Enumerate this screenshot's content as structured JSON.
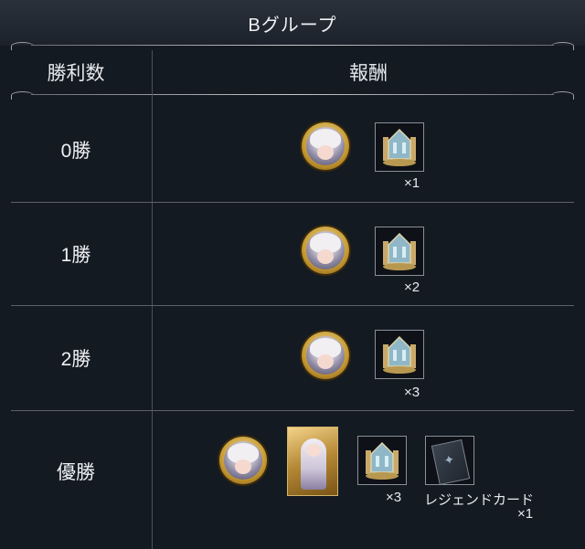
{
  "title": "Bグループ",
  "headers": {
    "wins": "勝利数",
    "reward": "報酬"
  },
  "rows": [
    {
      "wins": "0勝",
      "crown_qty": "×1"
    },
    {
      "wins": "1勝",
      "crown_qty": "×2"
    },
    {
      "wins": "2勝",
      "crown_qty": "×3"
    },
    {
      "wins": "優勝",
      "crown_qty": "×3",
      "legend_label": "レジェンドカード",
      "legend_qty": "×1"
    }
  ],
  "icons": {
    "medal": "character-medal-icon",
    "crown": "crown-trophy-icon",
    "card": "character-card-icon",
    "legend": "legend-card-icon"
  },
  "colors": {
    "background": "#141a22",
    "title_bar": "#2b313a",
    "gold": "#c79a32"
  }
}
